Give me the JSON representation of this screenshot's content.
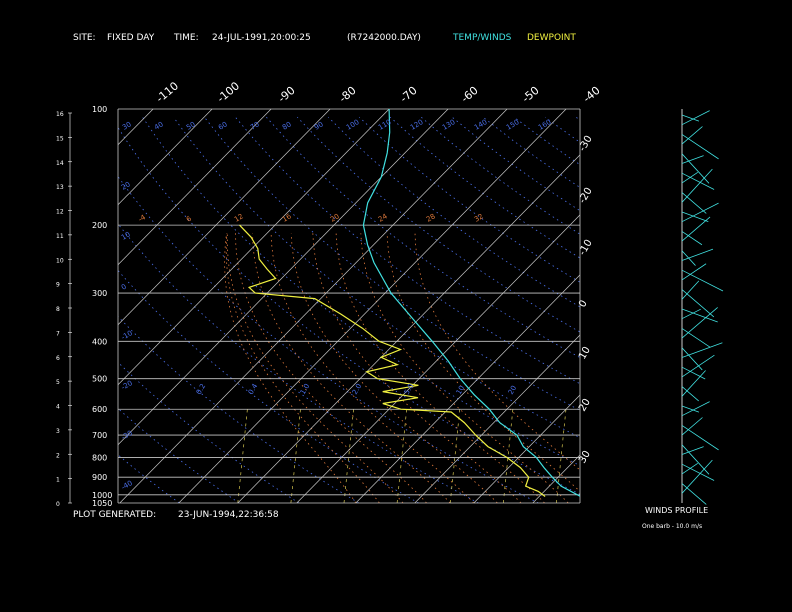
{
  "header": {
    "site_label": "SITE:",
    "site_value": "FIXED DAY",
    "time_label": "TIME:",
    "time_value": "24-JUL-1991,20:00:25",
    "file": "(R7242000.DAY)",
    "temp_label": "TEMP/WINDS",
    "dew_label": "DEWPOINT"
  },
  "footer": {
    "generated_label": "PLOT GENERATED:",
    "generated_value": "23-JUN-1994,22:36:58"
  },
  "winds_panel": {
    "title": "WINDS PROFILE",
    "note": "One barb - 10.0 m/s"
  },
  "colors": {
    "temp": "#40e0e0",
    "dewpoint": "#f0f040",
    "grid": "#c8c8c8",
    "dry_adiabat": "#4a6ee8",
    "moist_adiabat": "#e07a3c",
    "mixing_ratio": "#d8c850",
    "text": "#ffffff"
  },
  "chart_data": {
    "type": "line",
    "title": "",
    "pressure_levels": [
      100,
      200,
      300,
      400,
      500,
      600,
      700,
      800,
      900,
      1000,
      1050
    ],
    "height_ticks": [
      0,
      1,
      2,
      3,
      4,
      5,
      6,
      7,
      8,
      9,
      10,
      11,
      12,
      13,
      14,
      15,
      16
    ],
    "temp_ticks_top": [
      -110,
      -100,
      -90,
      -80,
      -70,
      -60,
      -50,
      -40
    ],
    "temp_ticks_right": [
      -30,
      -20,
      -10,
      0,
      10,
      20,
      30
    ],
    "dry_adiabat_labels_top": [
      "30",
      "40",
      "50",
      "60",
      "70",
      "80",
      "90",
      "100",
      "110",
      "120",
      "130",
      "140",
      "150",
      "160"
    ],
    "dry_adiabat_labels_left": [
      "20",
      "10",
      "0",
      "-10",
      "-20",
      "-30",
      "-40"
    ],
    "moist_adiabat_labels": [
      "-4",
      "6",
      "12",
      "16",
      "20",
      "24",
      "28",
      "32"
    ],
    "mixing_ratio_labels": [
      "0.2",
      "0.4",
      "1.0",
      "2.0",
      "5.0",
      "10",
      "20"
    ],
    "series": [
      {
        "name": "TEMP/WINDS",
        "points": [
          {
            "p": 1010,
            "t": 27
          },
          {
            "p": 950,
            "t": 22
          },
          {
            "p": 900,
            "t": 19
          },
          {
            "p": 850,
            "t": 16
          },
          {
            "p": 800,
            "t": 13
          },
          {
            "p": 750,
            "t": 9
          },
          {
            "p": 700,
            "t": 6
          },
          {
            "p": 650,
            "t": 1
          },
          {
            "p": 600,
            "t": -3
          },
          {
            "p": 550,
            "t": -8
          },
          {
            "p": 500,
            "t": -13
          },
          {
            "p": 450,
            "t": -18
          },
          {
            "p": 400,
            "t": -24
          },
          {
            "p": 350,
            "t": -31
          },
          {
            "p": 300,
            "t": -39
          },
          {
            "p": 250,
            "t": -47
          },
          {
            "p": 225,
            "t": -51
          },
          {
            "p": 200,
            "t": -55
          },
          {
            "p": 175,
            "t": -58
          },
          {
            "p": 150,
            "t": -60
          },
          {
            "p": 130,
            "t": -63
          },
          {
            "p": 115,
            "t": -66
          },
          {
            "p": 100,
            "t": -70
          }
        ]
      },
      {
        "name": "DEWPOINT",
        "points": [
          {
            "p": 1010,
            "t": 21
          },
          {
            "p": 980,
            "t": 19
          },
          {
            "p": 950,
            "t": 16
          },
          {
            "p": 900,
            "t": 15
          },
          {
            "p": 850,
            "t": 12
          },
          {
            "p": 800,
            "t": 8
          },
          {
            "p": 750,
            "t": 3
          },
          {
            "p": 700,
            "t": -1
          },
          {
            "p": 650,
            "t": -5
          },
          {
            "p": 610,
            "t": -9
          },
          {
            "p": 600,
            "t": -18
          },
          {
            "p": 580,
            "t": -22
          },
          {
            "p": 560,
            "t": -17
          },
          {
            "p": 540,
            "t": -24
          },
          {
            "p": 520,
            "t": -19
          },
          {
            "p": 500,
            "t": -27
          },
          {
            "p": 480,
            "t": -30
          },
          {
            "p": 460,
            "t": -26
          },
          {
            "p": 440,
            "t": -30
          },
          {
            "p": 420,
            "t": -28
          },
          {
            "p": 400,
            "t": -33
          },
          {
            "p": 370,
            "t": -38
          },
          {
            "p": 340,
            "t": -44
          },
          {
            "p": 310,
            "t": -51
          },
          {
            "p": 300,
            "t": -62
          },
          {
            "p": 290,
            "t": -64
          },
          {
            "p": 275,
            "t": -61
          },
          {
            "p": 260,
            "t": -64
          },
          {
            "p": 245,
            "t": -67
          },
          {
            "p": 230,
            "t": -69
          },
          {
            "p": 215,
            "t": -72
          },
          {
            "p": 200,
            "t": -76
          }
        ]
      }
    ],
    "wind_barb_count": 40,
    "grid": true,
    "legend": "top"
  }
}
